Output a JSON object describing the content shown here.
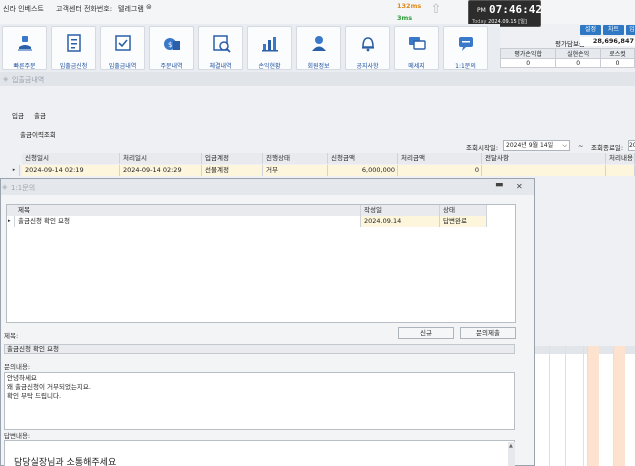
{
  "header": {
    "brand": "신라 인베스트",
    "callcenter_label": "고객센터 전화번호:",
    "callcenter_value": "텔레그램",
    "ping1": "132ms",
    "ping1_color": "#e08a1a",
    "ping2": "3ms",
    "ping2_color": "#2e9e3a"
  },
  "clock": {
    "ampm": "PM",
    "time": "07:46:42",
    "date_label": "Today",
    "date_value": "2024.09.15 [일]"
  },
  "toolbar": [
    {
      "label": "빠른주문",
      "icon": "quick-order-icon"
    },
    {
      "label": "입출금신청",
      "icon": "deposit-request-icon"
    },
    {
      "label": "입출금내역",
      "icon": "deposit-history-icon"
    },
    {
      "label": "주문내역",
      "icon": "order-history-icon"
    },
    {
      "label": "체결내역",
      "icon": "execution-history-icon"
    },
    {
      "label": "손익현황",
      "icon": "profit-status-icon"
    },
    {
      "label": "회원정보",
      "icon": "member-info-icon"
    },
    {
      "label": "공지사항",
      "icon": "notice-bell-icon"
    },
    {
      "label": "메세지",
      "icon": "message-icon"
    },
    {
      "label": "1:1문의",
      "icon": "inquiry-chat-icon"
    }
  ],
  "right_panel": {
    "btn1": "설정",
    "btn2": "차트",
    "btn3": "입",
    "accent": "#2f78c4",
    "eval_label": "평가담보금",
    "eval_value": "28,696,847",
    "cols": [
      "평가손익합",
      "실현손익",
      "로스컷"
    ],
    "vals": [
      "0",
      "0",
      "0"
    ]
  },
  "bg_window": {
    "title": "입출금내역",
    "tab1": "입금",
    "tab2": "출금",
    "subtitle": "출금이력조회",
    "start_label": "조회시작일:",
    "start_value": "2024년  9월 14일",
    "tilde": "~",
    "end_label": "조회종료일:",
    "end_value": "20",
    "columns": [
      "신청일시",
      "처리일시",
      "입금계정",
      "진행상태",
      "신청금액",
      "처리금액",
      "전달사항",
      "처리내용"
    ],
    "row": {
      "req_time": "2024-09-14 02:19",
      "proc_time": "2024-09-14 02:29",
      "account": "선물계정",
      "status": "거부",
      "req_amount": "6,000,000",
      "proc_amount": "0",
      "memo": "",
      "proc_note": ""
    },
    "row_color": "#fdf6dd"
  },
  "dialog": {
    "title": "1:1문의",
    "columns": [
      "제목",
      "작성일",
      "상태"
    ],
    "row": {
      "title": "출금신청 확인 요청",
      "date": "2024.09.14",
      "status": "답변완료"
    },
    "new_button": "신규",
    "delete_button": "문의제출",
    "subject_label": "제목:",
    "subject_value": "출금신청 확인 요청",
    "content_label": "문의내용:",
    "content_lines": [
      "안녕하세요",
      "왜 출금신청이 거부되었는지요.",
      "확인 부탁 드립니다."
    ],
    "answer_label": "답변내용:",
    "answer_text": "담당실장님과 소통해주세요"
  }
}
